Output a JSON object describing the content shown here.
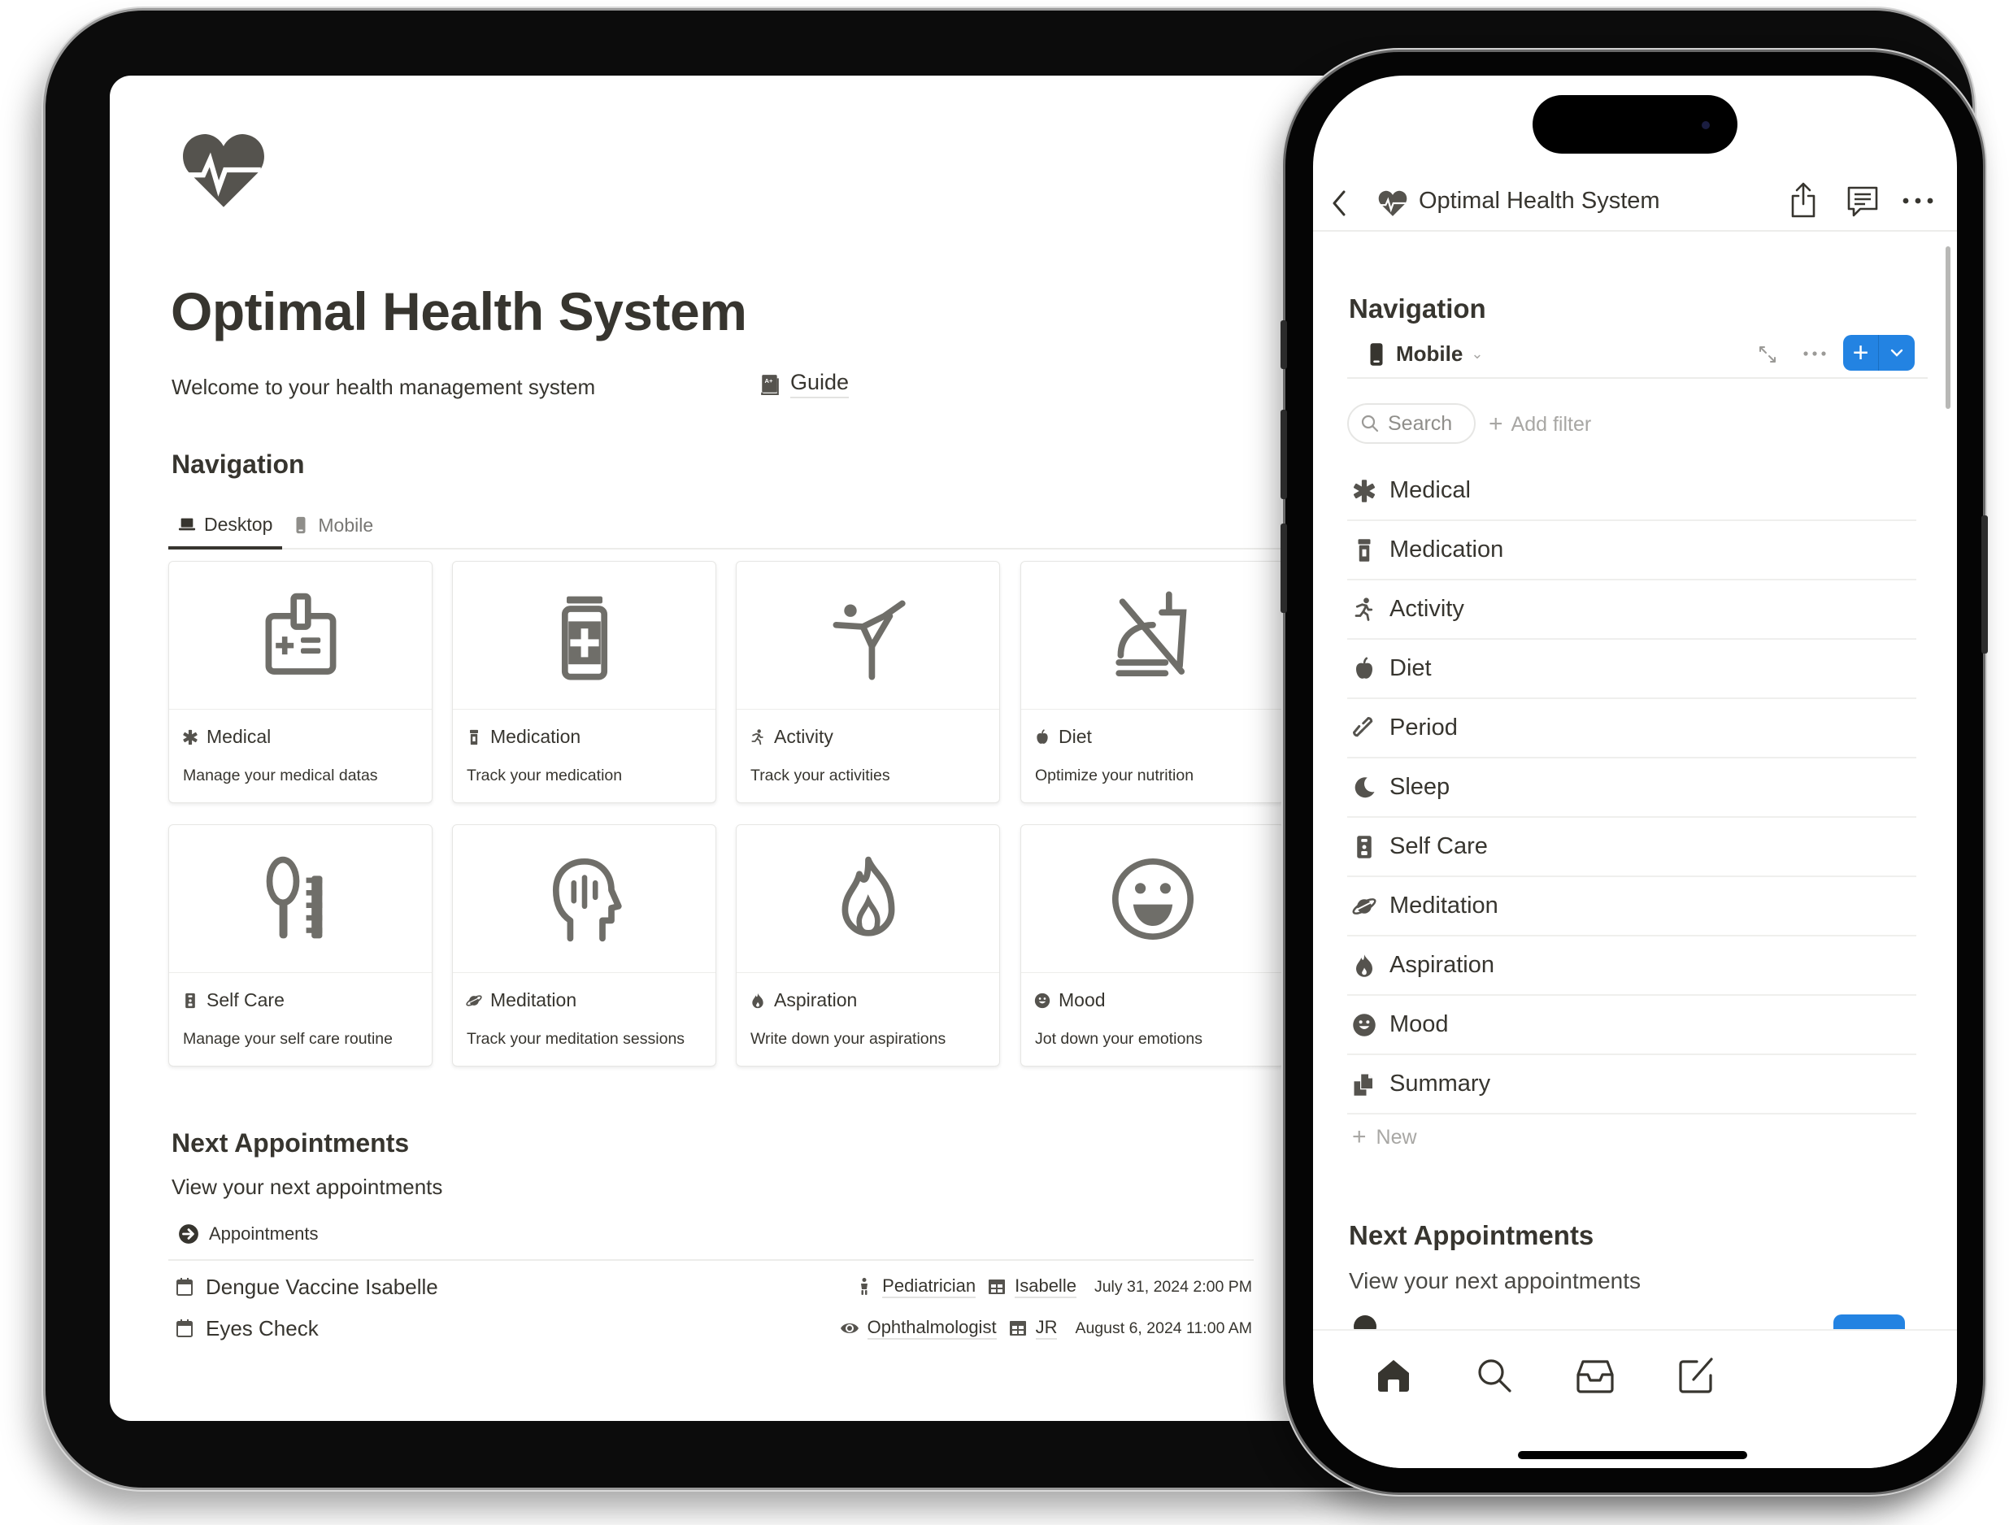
{
  "tablet": {
    "page_title": "Optimal Health System",
    "welcome_text": "Welcome to your health management system",
    "guide_label": "Guide",
    "navigation_heading": "Navigation",
    "tabs": [
      {
        "label": "Desktop",
        "icon": "laptop-icon",
        "active": true
      },
      {
        "label": "Mobile",
        "icon": "mobile-icon",
        "active": false
      }
    ],
    "cards": [
      {
        "title": "Medical",
        "desc": "Manage your medical datas",
        "icon": "asterisk-icon",
        "cover": "id-badge-icon"
      },
      {
        "title": "Medication",
        "desc": "Track your medication",
        "icon": "pill-bottle-icon",
        "cover": "medicine-jar-icon"
      },
      {
        "title": "Activity",
        "desc": "Track your activities",
        "icon": "running-icon",
        "cover": "martial-arts-icon"
      },
      {
        "title": "Diet",
        "desc": "Optimize your nutrition",
        "icon": "apple-icon",
        "cover": "no-food-icon"
      },
      {
        "title": "Self Care",
        "desc": "Manage your self care routine",
        "icon": "self-care-icon",
        "cover": "mirror-comb-icon"
      },
      {
        "title": "Meditation",
        "desc": "Track your meditation sessions",
        "icon": "planet-icon",
        "cover": "head-mind-icon"
      },
      {
        "title": "Aspiration",
        "desc": "Write down your aspirations",
        "icon": "flame-icon",
        "cover": "fire-icon"
      },
      {
        "title": "Mood",
        "desc": "Jot down your emotions",
        "icon": "smiley-icon",
        "cover": "smiley-face-icon"
      }
    ],
    "appointments_heading": "Next Appointments",
    "appointments_desc": "View your next appointments",
    "appointments_link": "Appointments",
    "appointments": [
      {
        "name": "Dengue Vaccine Isabelle",
        "specialty": "Pediatrician",
        "specialty_icon": "child-icon",
        "person": "Isabelle",
        "date": "July 31, 2024 2:00 PM"
      },
      {
        "name": "Eyes Check",
        "specialty": "Ophthalmologist",
        "specialty_icon": "eye-icon",
        "person": "JR",
        "date": "August 6, 2024 11:00 AM"
      }
    ]
  },
  "phone": {
    "header_title": "Optimal Health System",
    "navigation_heading": "Navigation",
    "view_name": "Mobile",
    "search_placeholder": "Search",
    "add_filter_label": "Add filter",
    "list": [
      {
        "label": "Medical",
        "icon": "asterisk-icon"
      },
      {
        "label": "Medication",
        "icon": "pill-bottle-icon"
      },
      {
        "label": "Activity",
        "icon": "running-icon"
      },
      {
        "label": "Diet",
        "icon": "apple-icon"
      },
      {
        "label": "Period",
        "icon": "link-icon"
      },
      {
        "label": "Sleep",
        "icon": "moon-icon"
      },
      {
        "label": "Self Care",
        "icon": "self-care-icon"
      },
      {
        "label": "Meditation",
        "icon": "planet-icon"
      },
      {
        "label": "Aspiration",
        "icon": "flame-icon"
      },
      {
        "label": "Mood",
        "icon": "smiley-icon"
      },
      {
        "label": "Summary",
        "icon": "documents-icon"
      }
    ],
    "new_label": "New",
    "appointments_heading": "Next Appointments",
    "appointments_desc": "View your next appointments",
    "tabbar": [
      "home-icon",
      "search-icon",
      "inbox-icon",
      "compose-icon"
    ]
  },
  "colors": {
    "text": "#37352f",
    "accent_blue": "#2383e2",
    "icon_gray": "#6f6e69",
    "divider": "#ececea"
  }
}
